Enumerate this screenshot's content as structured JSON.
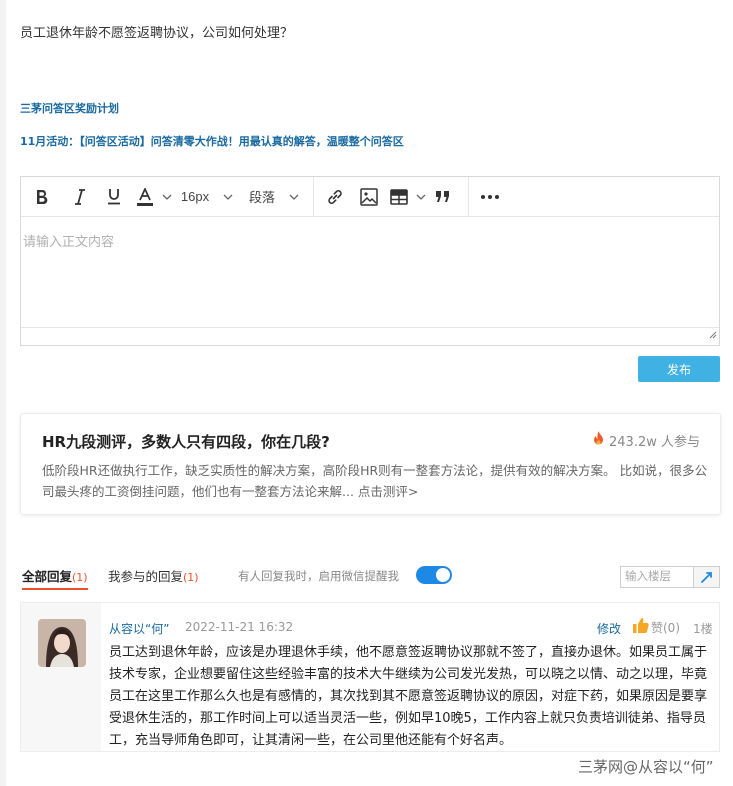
{
  "question": {
    "title": "员工退休年龄不愿签返聘协议，公司如何处理？"
  },
  "links": {
    "reward_plan": "三茅问答区奖励计划",
    "activity": "11月活动：【问答区活动】问答清零大作战！用最认真的解答，温暖整个问答区"
  },
  "editor": {
    "font_size": "16px",
    "paragraph": "段落",
    "placeholder": "请输入正文内容",
    "toolbar_icons": [
      "bold-icon",
      "italic-icon",
      "underline-icon",
      "font-color-icon",
      "link-icon",
      "image-icon",
      "table-icon",
      "quote-icon",
      "more-icon"
    ],
    "font_color": "#333333",
    "publish_label": "发布"
  },
  "promo": {
    "title": "HR九段测评，多数人只有四段，你在几段?",
    "participants": "243.2w 人参与",
    "description": "低阶段HR还做执行工作，缺乏实质性的解决方案，高阶段HR则有一整套方法论，提供有效的解决方案。 比如说，很多公司最头疼的工资倒挂问题，他们也有一整套方法论来解... 点击测评>"
  },
  "replies_tabs": {
    "all_label": "全部回复",
    "all_count": "(1)",
    "mine_label": "我参与的回复",
    "mine_count": "(1)",
    "notify_text": "有人回复我时，启用微信提醒我",
    "notify_enabled": true,
    "floor_placeholder": "输入楼层"
  },
  "replies": [
    {
      "user": "从容以“何”",
      "time": "2022-11-21 16:32",
      "edit_label": "修改",
      "like_label": "赞(0)",
      "floor": "1楼",
      "text": "员工达到退休年龄，应该是办理退休手续，他不愿意签返聘协议那就不签了，直接办退休。如果员工属于技术专家，企业想要留住这些经验丰富的技术大牛继续为公司发光发热，可以晓之以情、动之以理，毕竟员工在这里工作那么久也是有感情的，其次找到其不愿意签返聘协议的原因，对症下药，如果原因是要享受退休生活的，那工作时间上可以适当灵活一些，例如早10晚5，工作内容上就只负责培训徒弟、指导员工，充当导师角色即可，让其清闲一些，在公司里他还能有个好名声。"
    }
  ],
  "watermark": "三茅网@从容以“何”",
  "colors": {
    "link": "#1a6aa0",
    "publish": "#3fb1e3",
    "accent": "#e9522b",
    "toggle": "#1e88e5"
  }
}
